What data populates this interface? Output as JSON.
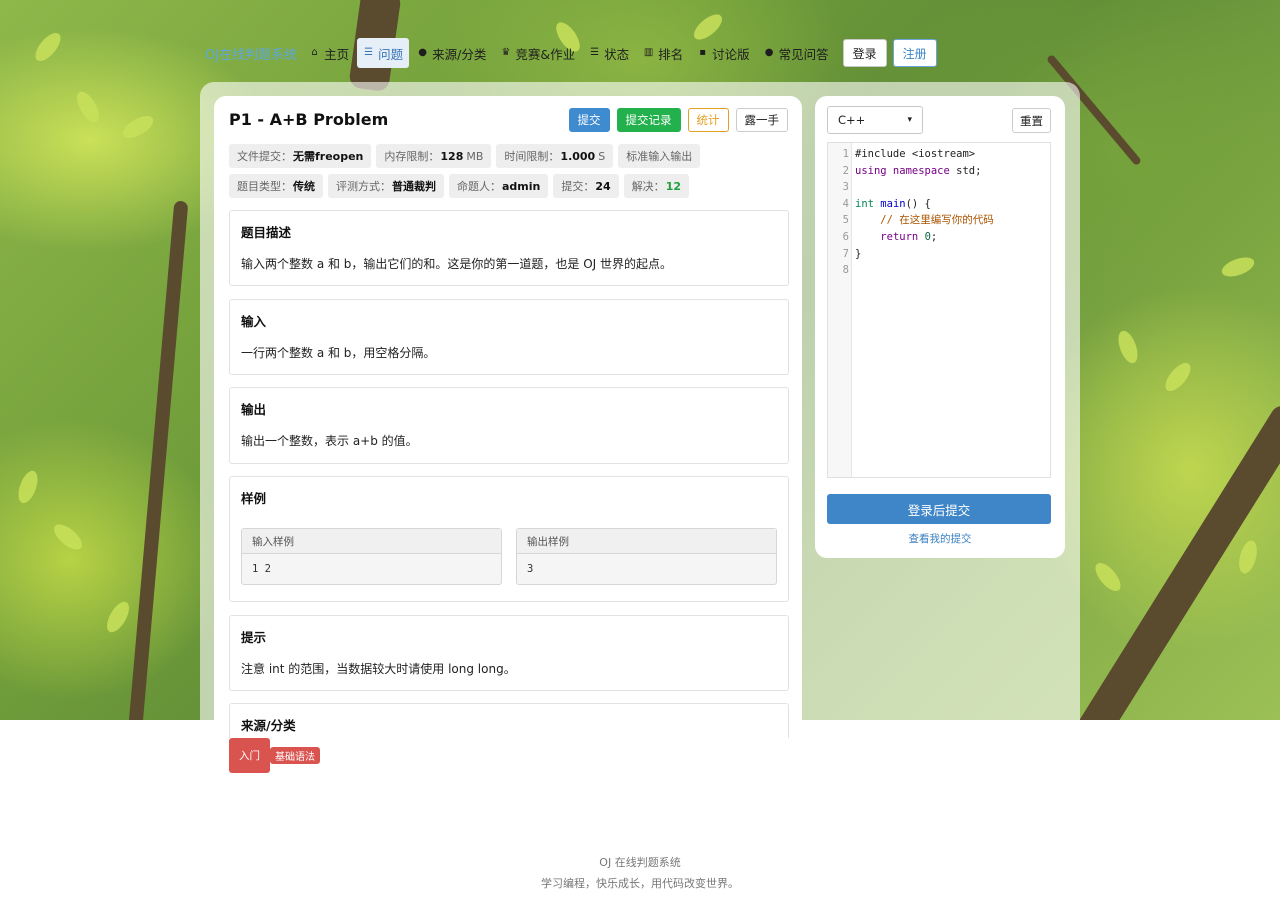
{
  "nav": {
    "brand": "OJ在线判题系统",
    "items": [
      {
        "label": "主页",
        "icon": "home-icon"
      },
      {
        "label": "问题",
        "icon": "list-icon"
      },
      {
        "label": "来源/分类",
        "icon": "dot-icon"
      },
      {
        "label": "竞赛&作业",
        "icon": "trophy-icon"
      },
      {
        "label": "状态",
        "icon": "status-list-icon"
      },
      {
        "label": "排名",
        "icon": "bar-chart-icon"
      },
      {
        "label": "讨论版",
        "icon": "comment-icon"
      },
      {
        "label": "常见问答",
        "icon": "dot-icon"
      }
    ],
    "login": "登录",
    "register": "注册"
  },
  "problem": {
    "title": "P1 - A+B Problem",
    "actions": {
      "submit": "提交",
      "records": "提交记录",
      "stats": "统计",
      "show": "露一手"
    },
    "meta": {
      "file_submit_label": "文件提交：",
      "file_submit_value": "无需freopen",
      "memory_label": "内存限制：",
      "memory_value": "128",
      "memory_unit": "MB",
      "time_label": "时间限制：",
      "time_value": "1.000",
      "time_unit": "S",
      "io_label": "标准输入输出",
      "type_label": "题目类型：",
      "type_value": "传统",
      "judge_label": "评测方式：",
      "judge_value": "普通裁判",
      "author_label": "命题人：",
      "author_value": "admin",
      "submit_label": "提交：",
      "submit_value": "24",
      "solved_label": "解决：",
      "solved_value": "12"
    },
    "sections": {
      "description": {
        "heading": "题目描述",
        "text": "输入两个整数 a 和 b，输出它们的和。这是你的第一道题，也是 OJ 世界的起点。"
      },
      "input": {
        "heading": "输入",
        "text": "一行两个整数 a 和 b，用空格分隔。"
      },
      "output": {
        "heading": "输出",
        "text": "输出一个整数，表示 a+b 的值。"
      },
      "sample": {
        "heading": "样例",
        "input_label": "输入样例",
        "input_value": "1 2",
        "output_label": "输出样例",
        "output_value": "3"
      },
      "hint": {
        "heading": "提示",
        "text": "注意 int 的范围，当数据较大时请使用 long long。"
      },
      "source": {
        "heading": "来源/分类",
        "tags": [
          "入门",
          "基础语法"
        ]
      }
    }
  },
  "editor": {
    "language": "C++",
    "reset": "重置",
    "line_numbers": [
      "1",
      "2",
      "3",
      "4",
      "5",
      "6",
      "7",
      "8"
    ],
    "submit_button": "登录后提交",
    "my_submissions": "查看我的提交"
  },
  "footer": {
    "line1": "OJ 在线判题系统",
    "line2": "学习编程，快乐成长，用代码改变世界。"
  }
}
